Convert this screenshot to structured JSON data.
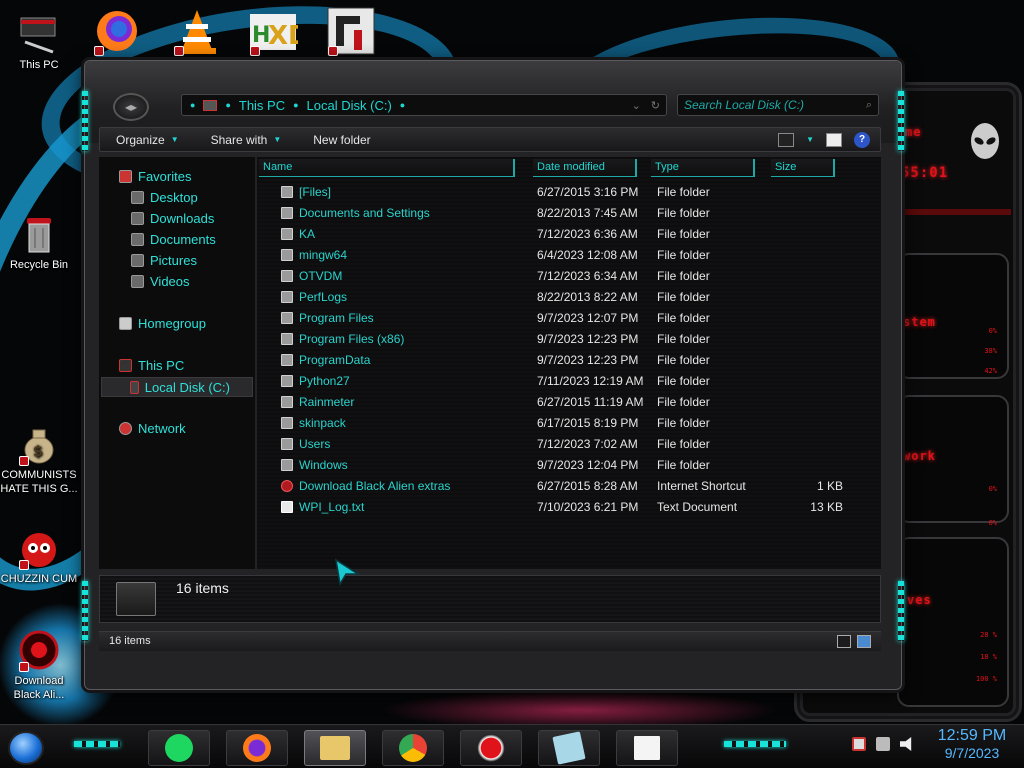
{
  "desktop": {
    "icons": [
      {
        "label": "This PC"
      },
      {
        "label": "Recycle Bin"
      },
      {
        "label": "COMMUNISTS HATE THIS G..."
      },
      {
        "label": "CHUZZIN CUM"
      },
      {
        "label": "Download Black Ali..."
      }
    ],
    "top_icons": [
      "firefox-icon",
      "vlc-icon",
      "hxd-icon",
      "rainmeter-skin-icon"
    ]
  },
  "explorer": {
    "address": {
      "crumbs": [
        "This PC",
        "Local Disk (C:)"
      ]
    },
    "search": {
      "placeholder": "Search Local Disk (C:)"
    },
    "commands": {
      "organize": "Organize",
      "share_with": "Share with",
      "new_folder": "New folder"
    },
    "nav": {
      "favorites": "Favorites",
      "desktop": "Desktop",
      "downloads": "Downloads",
      "documents": "Documents",
      "pictures": "Pictures",
      "videos": "Videos",
      "homegroup": "Homegroup",
      "this_pc": "This PC",
      "local_disk": "Local Disk (C:)",
      "network": "Network"
    },
    "columns": {
      "name": "Name",
      "date_modified": "Date modified",
      "type": "Type",
      "size": "Size"
    },
    "files": [
      {
        "name": "[Files]",
        "date": "6/27/2015 3:16 PM",
        "type": "File folder",
        "size": ""
      },
      {
        "name": "Documents and Settings",
        "date": "8/22/2013 7:45 AM",
        "type": "File folder",
        "size": ""
      },
      {
        "name": "KA",
        "date": "7/12/2023 6:36 AM",
        "type": "File folder",
        "size": ""
      },
      {
        "name": "mingw64",
        "date": "6/4/2023 12:08 AM",
        "type": "File folder",
        "size": ""
      },
      {
        "name": "OTVDM",
        "date": "7/12/2023 6:34 AM",
        "type": "File folder",
        "size": ""
      },
      {
        "name": "PerfLogs",
        "date": "8/22/2013 8:22 AM",
        "type": "File folder",
        "size": ""
      },
      {
        "name": "Program Files",
        "date": "9/7/2023 12:07 PM",
        "type": "File folder",
        "size": ""
      },
      {
        "name": "Program Files (x86)",
        "date": "9/7/2023 12:23 PM",
        "type": "File folder",
        "size": ""
      },
      {
        "name": "ProgramData",
        "date": "9/7/2023 12:23 PM",
        "type": "File folder",
        "size": ""
      },
      {
        "name": "Python27",
        "date": "7/11/2023 12:19 AM",
        "type": "File folder",
        "size": ""
      },
      {
        "name": "Rainmeter",
        "date": "6/27/2015 11:19 AM",
        "type": "File folder",
        "size": ""
      },
      {
        "name": "skinpack",
        "date": "6/17/2015 8:19 PM",
        "type": "File folder",
        "size": ""
      },
      {
        "name": "Users",
        "date": "7/12/2023 7:02 AM",
        "type": "File folder",
        "size": ""
      },
      {
        "name": "Windows",
        "date": "9/7/2023 12:04 PM",
        "type": "File folder",
        "size": ""
      },
      {
        "name": "Download Black Alien extras",
        "date": "6/27/2015 8:28 AM",
        "type": "Internet Shortcut",
        "size": "1 KB"
      },
      {
        "name": "WPI_Log.txt",
        "date": "7/10/2023 6:21 PM",
        "type": "Text Document",
        "size": "13 KB"
      }
    ],
    "details": {
      "count": "16 items"
    },
    "status": {
      "count": "16 items"
    }
  },
  "rainmeter": {
    "time": "55:01",
    "sections": [
      "me",
      "stem",
      "work",
      "ves"
    ],
    "cpu_values": [
      "0%",
      "38%",
      "42%"
    ],
    "net_values": [
      "0%",
      "0%"
    ],
    "disk_values": [
      "28 %",
      "18 %",
      "100 %"
    ]
  },
  "taskbar": {
    "apps": [
      "spotify-icon",
      "firefox-icon",
      "file-explorer-icon",
      "chrome-icon",
      "record-icon",
      "sticky-notes-icon",
      "notepad-icon"
    ],
    "clock": {
      "time": "12:59 PM",
      "date": "9/7/2023"
    }
  }
}
